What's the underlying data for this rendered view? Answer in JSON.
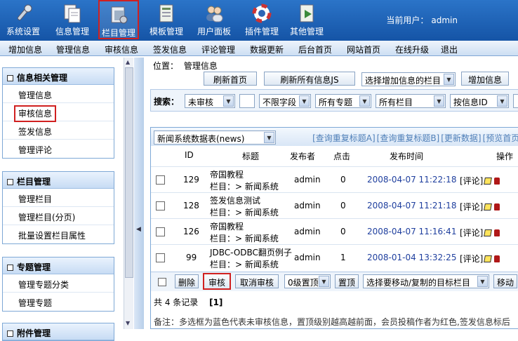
{
  "toolbar": {
    "items": [
      {
        "label": "系统设置",
        "icon": "wrench-icon"
      },
      {
        "label": "信息管理",
        "icon": "documents-icon"
      },
      {
        "label": "栏目管理",
        "icon": "folder-icon"
      },
      {
        "label": "模板管理",
        "icon": "template-icon"
      },
      {
        "label": "用户面板",
        "icon": "users-icon"
      },
      {
        "label": "插件管理",
        "icon": "lifebuoy-icon"
      },
      {
        "label": "其他管理",
        "icon": "media-icon"
      }
    ],
    "user_label": "当前用户：",
    "user_name": "admin"
  },
  "menu": [
    "增加信息",
    "管理信息",
    "审核信息",
    "签发信息",
    "评论管理",
    "数据更新",
    "后台首页",
    "网站首页",
    "在线升级",
    "退出"
  ],
  "sidebar": {
    "panels": [
      {
        "title": "信息相关管理",
        "items": [
          "管理信息",
          "审核信息",
          "签发信息",
          "管理评论"
        ]
      },
      {
        "title": "栏目管理",
        "items": [
          "管理栏目",
          "管理栏目(分页)",
          "批量设置栏目属性"
        ]
      },
      {
        "title": "专题管理",
        "items": [
          "管理专题分类",
          "管理专题"
        ]
      },
      {
        "title": "附件管理",
        "items": []
      }
    ]
  },
  "main": {
    "location_label": "位置：",
    "location_link": "管理信息",
    "buttons": {
      "refresh_home": "刷新首页",
      "refresh_all_js": "刷新所有信息JS",
      "add_column_select": "选择增加信息的栏目",
      "add_info": "增加信息"
    },
    "search": {
      "label": "搜索：",
      "status": "未审核",
      "field": "不限字段",
      "topic": "所有专题",
      "column": "所有栏目",
      "order": "按信息ID"
    },
    "table_select": "新闻系统数据表(news)",
    "links": [
      "[查询重复标题A]",
      "[查询重复标题B]",
      "[更新数据]",
      "[预览首页]"
    ],
    "headers": {
      "id": "ID",
      "title": "标题",
      "publisher": "发布者",
      "clicks": "点击",
      "time": "发布时间",
      "ops": "操作"
    },
    "rows": [
      {
        "id": "129",
        "title": "帝国教程",
        "column": "栏目：> 新闻系统",
        "publisher": "admin",
        "clicks": "0",
        "time": "2008-04-07 11:22:18",
        "comment": "[评论]"
      },
      {
        "id": "128",
        "title": "签发信息测试",
        "column": "栏目：> 新闻系统",
        "publisher": "admin",
        "clicks": "0",
        "time": "2008-04-07 11:21:18",
        "comment": "[评论]"
      },
      {
        "id": "126",
        "title": "帝国教程",
        "column": "栏目：> 新闻系统",
        "publisher": "admin",
        "clicks": "0",
        "time": "2008-04-07 11:16:41",
        "comment": "[评论]"
      },
      {
        "id": "99",
        "title": "JDBC-ODBC翻页例子",
        "column": "栏目：> 新闻系统",
        "publisher": "admin",
        "clicks": "1",
        "time": "2008-01-04 13:32:25",
        "comment": "[评论]"
      }
    ],
    "bottom": {
      "delete": "删除",
      "audit": "审核",
      "cancel_audit": "取消审核",
      "top_level": "0级置顶",
      "set_top": "置顶",
      "move_select": "选择要移动/复制的目标栏目",
      "move": "移动"
    },
    "total": "共 4 条记录",
    "page": "[1]",
    "note": "备注：多选框为蓝色代表未审核信息，置顶级别越高越前面，会员投稿作者为红色,签发信息标后"
  }
}
